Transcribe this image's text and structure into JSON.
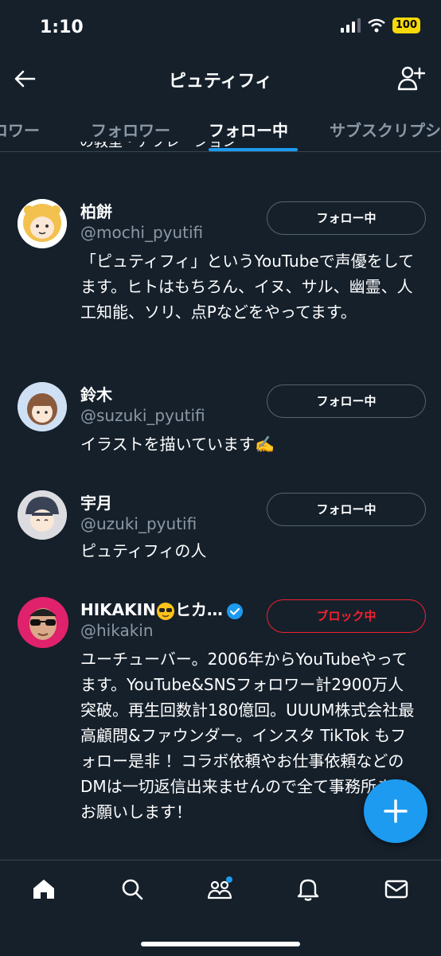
{
  "status_bar": {
    "time": "1:10",
    "battery": "100"
  },
  "header": {
    "title": "ピュティフィ"
  },
  "tabs": [
    {
      "label": "ロワー"
    },
    {
      "label": "フォロワー"
    },
    {
      "label": "フォロー中",
      "active": true
    },
    {
      "label": "サブスクリプシ"
    }
  ],
  "cutoff_text": "の教室・アフレーション",
  "users": [
    {
      "name": "柏餅",
      "handle": "@mochi_pyutifi",
      "button": "フォロー中",
      "bio": "「ピュティフィ」というYouTubeで声優をしてます。ヒトはもちろん、イヌ、サル、幽霊、人工知能、ソリ、点Pなどをやってます。"
    },
    {
      "name": "鈴木",
      "handle": "@suzuki_pyutifi",
      "button": "フォロー中",
      "bio": "イラストを描いています✍️"
    },
    {
      "name": "宇月",
      "handle": "@uzuki_pyutifi",
      "button": "フォロー中",
      "bio": "ピュティフィの人"
    },
    {
      "name": "HIKAKIN",
      "name_suffix": "ヒカ…",
      "handle": "@hikakin",
      "button": "ブロック中",
      "verified": true,
      "bio": "ユーチューバー。2006年からYouTubeやってます。YouTube&SNSフォロワー計2900万人突破。再生回数計180億回。UUUM株式会社最高顧問&ファウンダー。インスタ TikTok もフォロー是非 ！コラボ依頼やお仕事依頼などのDMは一切返信出来ませんので全て事務所までお願いします！"
    }
  ],
  "colors": {
    "background": "#15202b",
    "accent": "#1d9bf0",
    "secondary_text": "#8b98a5",
    "block": "#f4212e"
  },
  "icons": {
    "back": "arrow-left-icon",
    "add_user": "person-plus-icon",
    "compose": "plus-icon",
    "nav": [
      "home-icon",
      "search-icon",
      "communities-icon",
      "bell-icon",
      "mail-icon"
    ]
  }
}
